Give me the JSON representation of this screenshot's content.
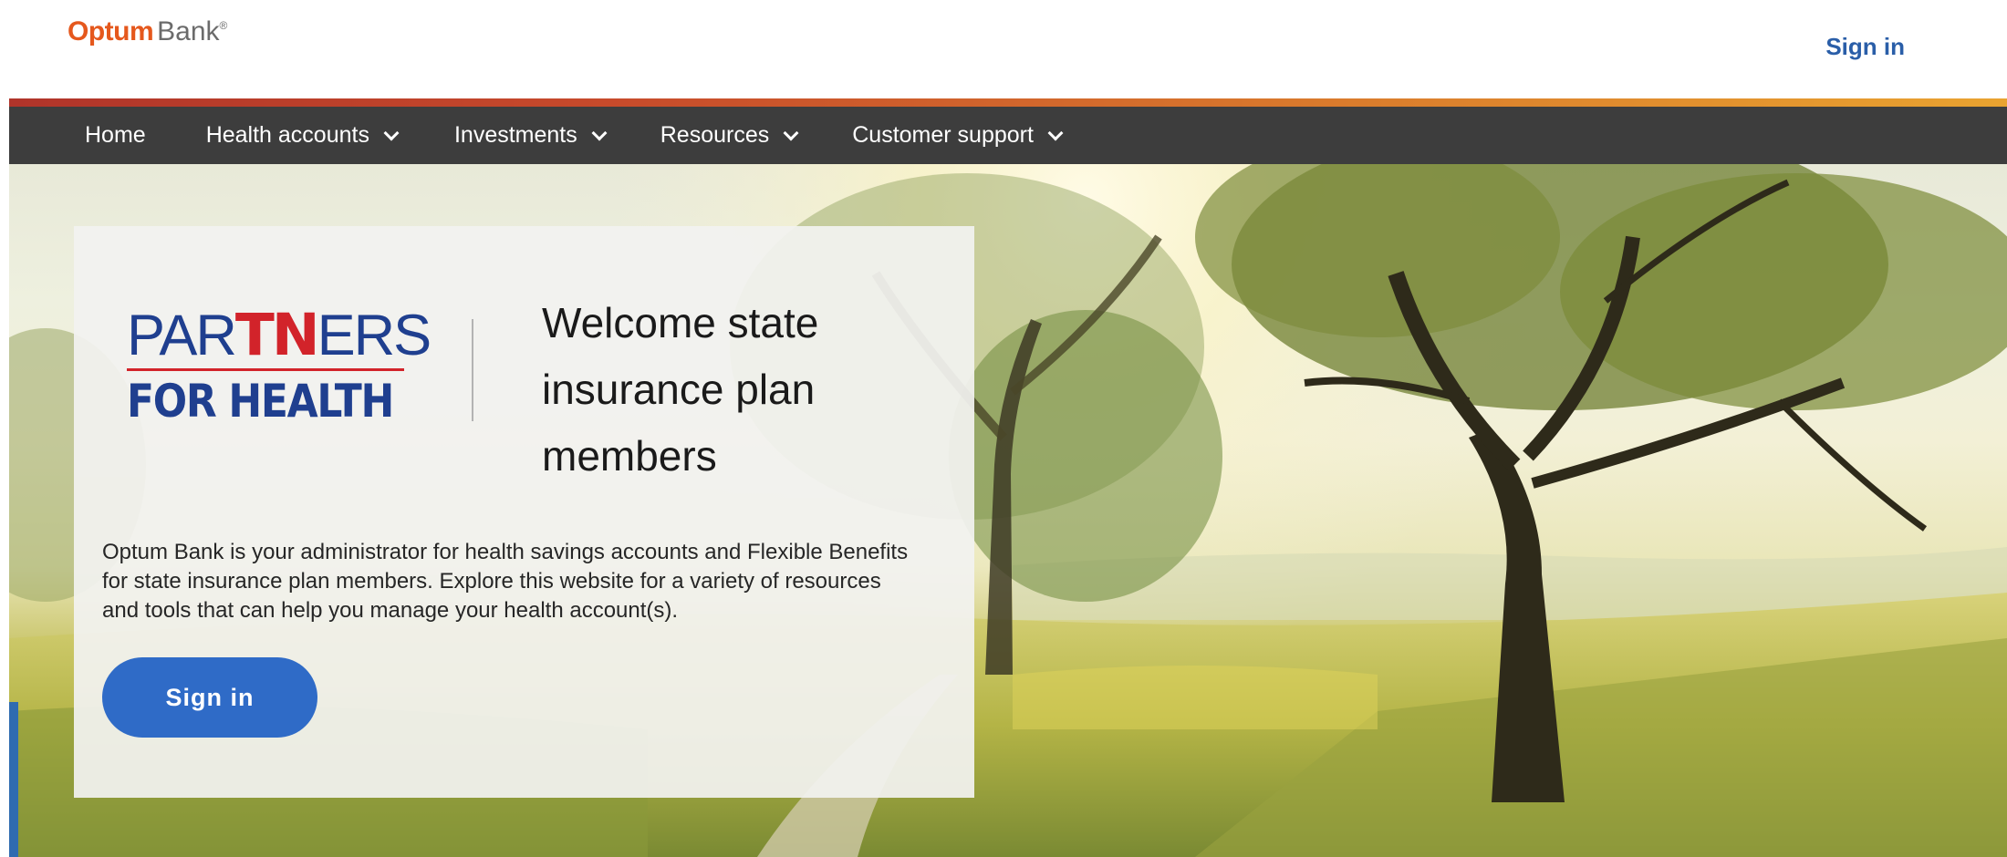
{
  "header": {
    "logo": {
      "brand": "Optum",
      "product": "Bank",
      "mark": "®"
    },
    "sign_in_label": "Sign in"
  },
  "nav": {
    "items": [
      {
        "label": "Home",
        "has_dropdown": false
      },
      {
        "label": "Health accounts",
        "has_dropdown": true
      },
      {
        "label": "Investments",
        "has_dropdown": true
      },
      {
        "label": "Resources",
        "has_dropdown": true
      },
      {
        "label": "Customer support",
        "has_dropdown": true
      }
    ]
  },
  "hero": {
    "partner_logo": {
      "line1_a": "PAR",
      "line1_b": "TN",
      "line1_c": "ERS",
      "line2": "FOR HEALTH"
    },
    "welcome_line1": "Welcome state",
    "welcome_line2": "insurance plan",
    "welcome_line3": "members",
    "description": "Optum Bank is your administrator for health savings accounts and Flexible Benefits for state insurance plan members. Explore this website for a variety of resources and tools that can help you manage your health account(s).",
    "sign_in_button": "Sign in"
  },
  "colors": {
    "optum_orange": "#e5581d",
    "nav_background": "#3d3d3d",
    "link_blue": "#2a5ea8",
    "button_blue": "#2f6bc7",
    "partners_navy": "#1f3f8f",
    "partners_red": "#d2232a"
  }
}
